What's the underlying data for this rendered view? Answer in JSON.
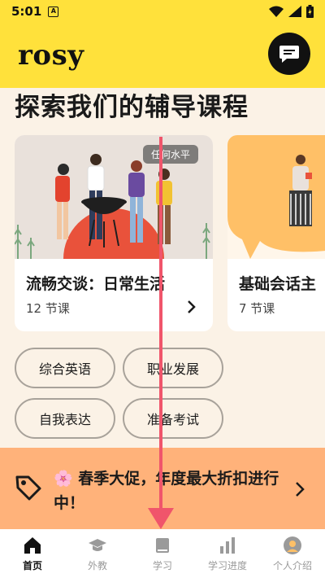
{
  "status_bar": {
    "time": "5:01",
    "notification": "A"
  },
  "header": {
    "logo": "rosy"
  },
  "section": {
    "title": "探索我们的辅导课程"
  },
  "courses": [
    {
      "badge": "任何水平",
      "title": "流畅交谈：日常生活",
      "lessons": "12 节课"
    },
    {
      "title": "基础会话主",
      "lessons": "7 节课"
    }
  ],
  "chips": [
    "综合英语",
    "职业发展",
    "自我表达",
    "准备考试"
  ],
  "promo": {
    "emoji": "🌸",
    "text": "春季大促，年度最大折扣进行中！"
  },
  "nav": {
    "items": [
      {
        "label": "首页",
        "icon": "home-icon"
      },
      {
        "label": "外教",
        "icon": "graduation-cap-icon"
      },
      {
        "label": "学习",
        "icon": "book-icon"
      },
      {
        "label": "学习进度",
        "icon": "bar-chart-icon"
      },
      {
        "label": "个人介绍",
        "icon": "profile-icon"
      }
    ]
  },
  "colors": {
    "header": "#FFE13B",
    "background": "#FBF2E6",
    "promo": "#FFB27A",
    "annotation": "#F0556B"
  }
}
